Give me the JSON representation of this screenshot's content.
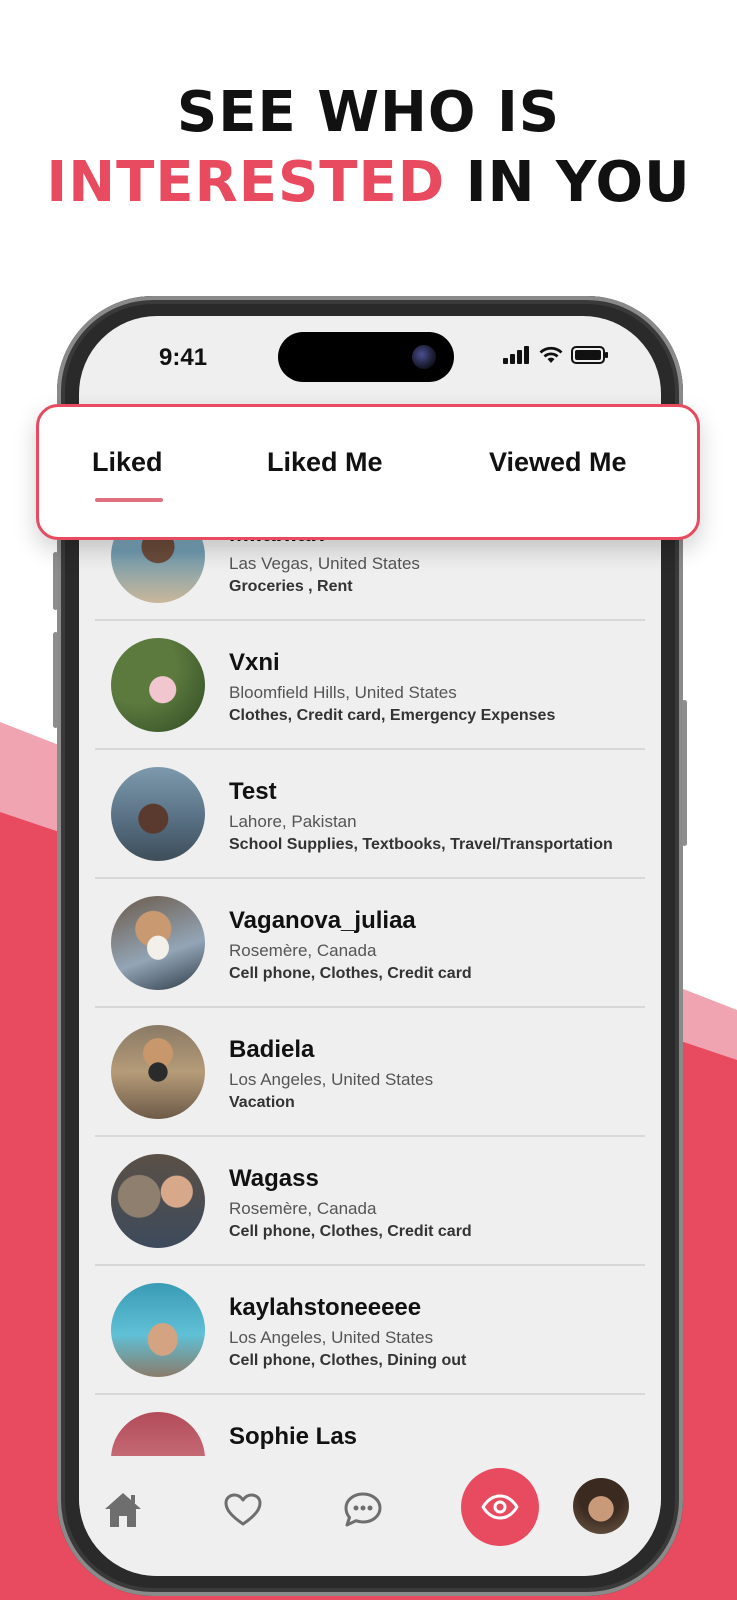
{
  "headline": {
    "line1": "SEE WHO IS",
    "line2_accent": "INTERESTED",
    "line2_rest": " IN YOU"
  },
  "colors": {
    "accent": "#e84a5f",
    "accent_light": "#f0a3b0",
    "screen_bg": "#efefef"
  },
  "status_bar": {
    "time": "9:41",
    "icons": [
      "signal-icon",
      "wifi-icon",
      "battery-icon"
    ]
  },
  "tabs": [
    {
      "label": "Liked",
      "active": true
    },
    {
      "label": "Liked Me",
      "active": false
    },
    {
      "label": "Viewed Me",
      "active": false
    }
  ],
  "list": [
    {
      "name": "Milanian",
      "location": "Las Vegas, United States",
      "tags": "Groceries , Rent"
    },
    {
      "name": "Vxni",
      "location": "Bloomfield Hills, United States",
      "tags": "Clothes, Credit card, Emergency Expenses"
    },
    {
      "name": "Test",
      "location": "Lahore, Pakistan",
      "tags": "School Supplies, Textbooks, Travel/Transportation"
    },
    {
      "name": "Vaganova_juliaa",
      "location": "Rosemère, Canada",
      "tags": "Cell phone, Clothes, Credit card"
    },
    {
      "name": "Badiela",
      "location": "Los Angeles, United States",
      "tags": "Vacation"
    },
    {
      "name": "Wagass",
      "location": "Rosemère, Canada",
      "tags": "Cell phone, Clothes, Credit card"
    },
    {
      "name": "kaylahstoneeeee",
      "location": "Los Angeles, United States",
      "tags": "Cell phone, Clothes, Dining out"
    },
    {
      "name": "Sophie Las",
      "location": "",
      "tags": ""
    }
  ],
  "bottom_nav": {
    "items": [
      "home-icon",
      "heart-icon",
      "chat-icon",
      "eye-icon",
      "profile-avatar"
    ],
    "active": "eye-icon"
  }
}
